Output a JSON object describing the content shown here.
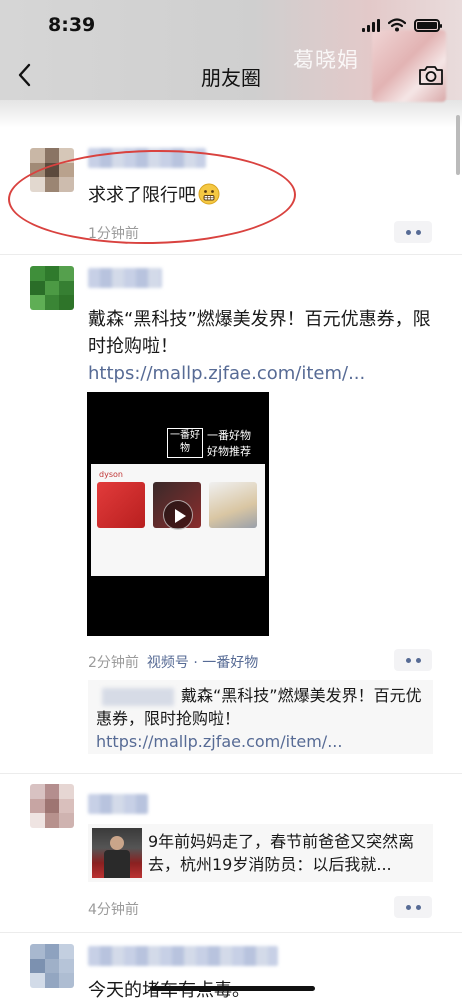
{
  "status_bar": {
    "time": "8:39"
  },
  "header": {
    "title": "朋友圈",
    "cover_name": "葛晓娟"
  },
  "posts": [
    {
      "text": "求求了限行吧",
      "emoji": "grimace-emoji",
      "time": "1分钟前"
    },
    {
      "text": "戴森“黑科技”燃爆美发界！百元优惠券，限时抢购啦！",
      "link": "https://mallp.zjfae.com/item/...",
      "video": {
        "logo": "一番好物",
        "title_line1": "一番好物",
        "title_line2": "好物推荐",
        "brand": "dyson"
      },
      "time": "2分钟前",
      "source": "视频号 · 一番好物",
      "quote_text": "戴森“黑科技”燃爆美发界！百元优惠券，限时抢购啦！",
      "quote_link": "https://mallp.zjfae.com/item/..."
    },
    {
      "share_title": "9年前妈妈走了，春节前爸爸又突然离去，杭州19岁消防员：以后我就...",
      "time": "4分钟前"
    },
    {
      "text": "今天的堵车有点毒。"
    }
  ],
  "colors": {
    "link": "#576b95",
    "annotation_circle": "#d9423f",
    "muted": "#9b9b9b"
  }
}
